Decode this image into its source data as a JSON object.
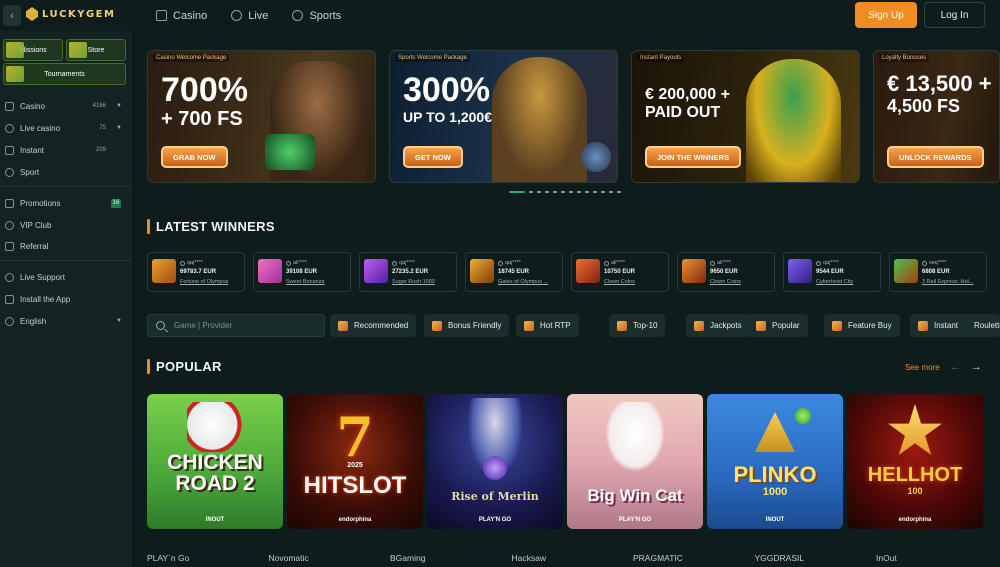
{
  "header": {
    "logo_text": "LUCKYGEM",
    "nav": [
      {
        "label": "Casino",
        "icon": "casino-icon"
      },
      {
        "label": "Live",
        "icon": "live-icon"
      },
      {
        "label": "Sports",
        "icon": "sports-icon"
      }
    ],
    "signup_label": "Sign Up",
    "login_label": "Log In"
  },
  "sidebar": {
    "promo_tiles": [
      "Missions",
      "Store",
      "Tournaments"
    ],
    "items": [
      {
        "label": "Casino",
        "count": "4166"
      },
      {
        "label": "Live casino",
        "count": "75"
      },
      {
        "label": "Instant",
        "count": "209"
      },
      {
        "label": "Sport"
      },
      {
        "label": "Promotions",
        "badge": "16"
      },
      {
        "label": "VIP Club"
      },
      {
        "label": "Referral"
      },
      {
        "label": "Live Support"
      },
      {
        "label": "Install the App"
      },
      {
        "label": "English"
      }
    ]
  },
  "banners": [
    {
      "tag": "Casino Welcome Package",
      "line1": "700%",
      "line2": "+ 700 FS",
      "cta": "GRAB NOW"
    },
    {
      "tag": "Sports Welcome Package",
      "line1": "300%",
      "line2": "UP TO 1,200€",
      "cta": "GET NOW"
    },
    {
      "tag": "Instant Payouts",
      "line1": "€ 200,000 +",
      "line2": "PAID OUT",
      "cta": "JOIN THE WINNERS"
    },
    {
      "tag": "Loyalty Bonuses",
      "line1": "€ 13,500 +",
      "line2": "4,500 FS",
      "cta": "UNLOCK REWARDS"
    }
  ],
  "carousel": {
    "active_index": 0,
    "total": 13
  },
  "latest_winners": {
    "title": "LATEST WINNERS",
    "items": [
      {
        "user": "qaj****",
        "amount": "69783.7 EUR",
        "game": "Fortune of Olympus"
      },
      {
        "user": "ali****",
        "amount": "39108 EUR",
        "game": "Sweet Bonanza"
      },
      {
        "user": "qaj****",
        "amount": "27235.2 EUR",
        "game": "Sugar Rush 1000"
      },
      {
        "user": "qaj****",
        "amount": "18745 EUR",
        "game": "Gates of Olympus ..."
      },
      {
        "user": "ali****",
        "amount": "10750 EUR",
        "game": "Clown Coins"
      },
      {
        "user": "ali****",
        "amount": "9650 EUR",
        "game": "Clown Coins"
      },
      {
        "user": "qaj****",
        "amount": "9544 EUR",
        "game": "Cyberheist City"
      },
      {
        "user": "seq****",
        "amount": "6808 EUR",
        "game": "3 Rail Express: Hol..."
      }
    ]
  },
  "search": {
    "placeholder": "Game | Provider"
  },
  "filters": [
    "Recommended",
    "Bonus Friendly",
    "Hot RTP",
    "Top-10",
    "Jackpots",
    "Popular",
    "Feature Buy",
    "Instant",
    "Roulette"
  ],
  "popular": {
    "title": "POPULAR",
    "see_more": "See more",
    "games": [
      {
        "title": "CHICKEN ROAD 2",
        "maker": "INOUT"
      },
      {
        "title": "HITSLOT",
        "subtitle": "2025",
        "maker": "endorphina"
      },
      {
        "title": "Rise of Merlin",
        "maker": "PLAY'N GO"
      },
      {
        "title": "Big Win Cat",
        "maker": "PLAY'N GO"
      },
      {
        "title": "PLINKO",
        "subtitle": "1000",
        "maker": "INOUT"
      },
      {
        "title": "HELLHOT",
        "subtitle": "100",
        "maker": "endorphina"
      }
    ]
  },
  "providers": [
    "PLAY`n Go",
    "Novomatic",
    "BGaming",
    "Hacksaw",
    "PRAGMATIC",
    "YGGDRASIL",
    "InOut"
  ],
  "colors": {
    "accent": "#ef8c23",
    "background": "#0f1c1c",
    "sidebar": "#132322",
    "active_dot": "#1fb476"
  }
}
